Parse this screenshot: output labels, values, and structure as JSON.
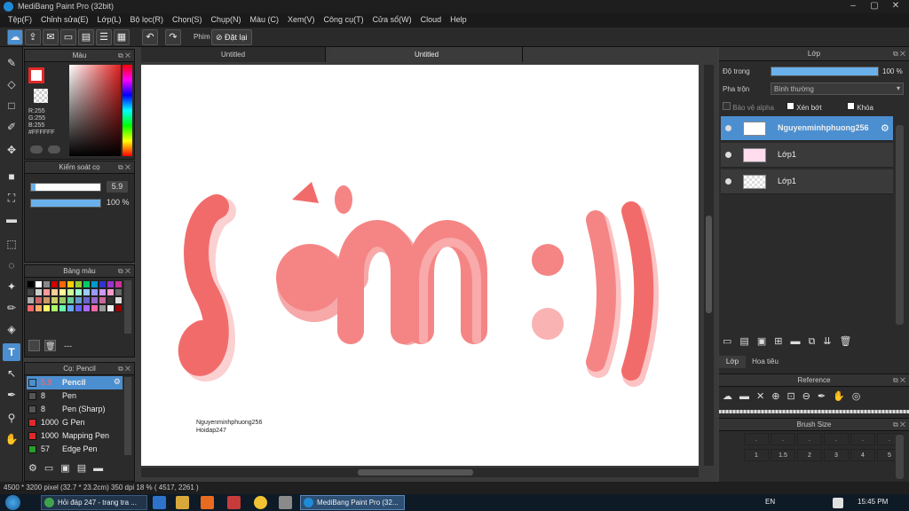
{
  "window": {
    "title": "MediBang Paint Pro (32bit)"
  },
  "menu": [
    "Tệp(F)",
    "Chỉnh sửa(E)",
    "Lớp(L)",
    "Bộ lọc(R)",
    "Chọn(S)",
    "Chụp(N)",
    "Màu (C)",
    "Xem(V)",
    "Công cụ(T)",
    "Cửa sổ(W)",
    "Cloud",
    "Help"
  ],
  "toolbar": {
    "label": "Phím",
    "reset_label": "Đặt lại"
  },
  "color_panel": {
    "title": "Màu",
    "r": "R:255",
    "g": "G:255",
    "b": "B:255",
    "hex": "#FFFFFF",
    "accent": "#e02a2a"
  },
  "brush_control": {
    "title": "Kiểm soát cọ",
    "size": "5.9",
    "opacity": "100 %"
  },
  "palette": {
    "title": "Bảng màu",
    "footer": "---"
  },
  "brush_panel": {
    "title": "Cọ: Pencil",
    "items": [
      {
        "size": "5.9",
        "name": "Pencil"
      },
      {
        "size": "8",
        "name": "Pen"
      },
      {
        "size": "8",
        "name": "Pen (Sharp)"
      },
      {
        "size": "1000",
        "name": "G Pen"
      },
      {
        "size": "1000",
        "name": "Mapping Pen"
      },
      {
        "size": "57",
        "name": "Edge Pen"
      }
    ]
  },
  "tabs": [
    "Untitled",
    "Untitled"
  ],
  "canvas": {
    "line1": "Nguyenminhphuong256",
    "line2": "Hoidap247",
    "art_color": "#f26b6b"
  },
  "layers_panel": {
    "title": "Lớp",
    "opacity_label": "Độ trong",
    "opacity_value": "100 %",
    "blend_label": "Pha trộn",
    "blend_value": "Bình thường",
    "protect_alpha": "Bảo vệ alpha",
    "clipping": "Xén bớt",
    "lock": "Khóa",
    "layers": [
      {
        "name": "Nguyenminhphuong256"
      },
      {
        "name": "Lớp1"
      },
      {
        "name": "Lớp1"
      }
    ],
    "tab_layers": "Lớp",
    "tab_navigator": "Hoa tiêu"
  },
  "reference": {
    "title": "Reference"
  },
  "brush_size": {
    "title": "Brush Size",
    "values": [
      ".",
      ".",
      ".",
      ".",
      ".",
      ".",
      "1",
      "1.5",
      "2",
      "3",
      "4",
      "5"
    ]
  },
  "status": {
    "text": "4500 * 3200 pixel  (32.7 * 23.2cm)  350 dpi  18 %  ( 4517, 2261 )"
  },
  "taskbar": {
    "item1": "Hỏi đáp 247 - trang tra ...",
    "item2": "MediBang Paint Pro (32...",
    "lang": "EN",
    "time": "15:45 PM"
  }
}
